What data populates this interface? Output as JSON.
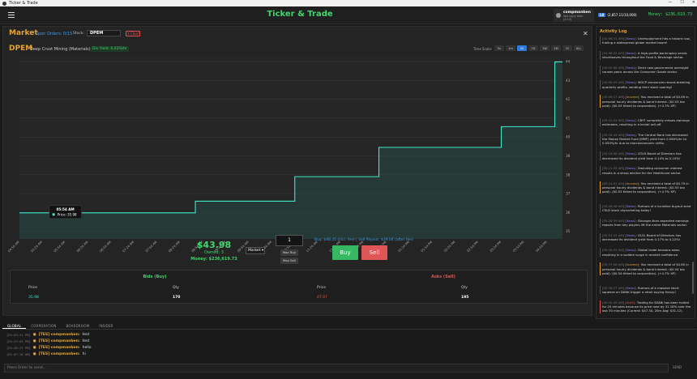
{
  "window": {
    "title": "Ticker & Trade",
    "controls": [
      "—",
      "☐",
      "✕"
    ]
  },
  "header": {
    "title": "Ticker & Trade",
    "user": {
      "name": "compmanben",
      "subtitle": "lost copy bots (2:13)"
    },
    "level": "L8",
    "xp": "(2,857.11/10,000)",
    "money": "Money: $236,619.73"
  },
  "market": {
    "title": "Market",
    "open_orders": "Open Orders: 0/15",
    "stock_label": "Stock:",
    "stock_value": "DPEM",
    "clear_label": "X Clear",
    "close": "✕",
    "ticker": "DPEM",
    "company": "Deep Crust Mining (Materials)",
    "div_yield": "Div Yield: 0.03%/hr",
    "timescale_label": "Time Scale:",
    "timescales": [
      "5s",
      "1m",
      "1h",
      "1D",
      "1W",
      "1M",
      "1Y",
      "ALL"
    ],
    "active_timescale": "1h",
    "tooltip_time": "05:54 AM",
    "tooltip_price": "Price: 35.98",
    "price_big": "$43.98",
    "owned": "Owned: 3",
    "money": "Money: $236,619.73",
    "order_type": "Market",
    "quantity": "1",
    "max_buy": "Max Buy",
    "max_sell": "Max Sell",
    "payout": "Buy: $48.35 (incl. fee) | Sell Payout: $39.04 (after fee)",
    "buy_label": "Buy",
    "sell_label": "Sell",
    "bids_title": "Bids (Buy)",
    "asks_title": "Asks (Sell)",
    "price_col": "Price",
    "qty_col": "Qty",
    "bid_price": "35.98",
    "bid_qty": "170",
    "ask_price": "47.97",
    "ask_qty": "195"
  },
  "chart_data": {
    "type": "line",
    "x": [
      "04:54 AM",
      "05:04 AM",
      "05:14 AM",
      "05:24 AM",
      "05:34 AM",
      "05:44 AM",
      "05:54 AM",
      "06:04 AM",
      "06:14 AM",
      "06:24 AM",
      "06:34 AM",
      "06:44 AM",
      "06:54 AM",
      "07:04 AM",
      "07:14 AM",
      "07:24 AM",
      "07:34 AM",
      "07:44 AM",
      "07:54 AM",
      "08:04 AM",
      "08:14 AM",
      "08:24 AM",
      "08:34 AM",
      "08:44 AM",
      "08:54 AM",
      "09:04 AM",
      "09:14 AM",
      "09:24 AM",
      "09:34 AM",
      "09:44 AM",
      "09:54 AM",
      "10:04 AM",
      "10:14 AM",
      "10:24 AM",
      "10:34 AM",
      "10:44 AM",
      "10:54 AM",
      "11:04 AM",
      "11:14 AM",
      "11:24 AM",
      "11:34 AM",
      "11:44 AM",
      "11:54 AM",
      "12:04 PM",
      "12:14 PM",
      "12:24 PM",
      "12:34 PM",
      "12:44 PM",
      "12:54 PM",
      "01:04 PM",
      "01:14 PM",
      "01:24 PM",
      "01:34 PM",
      "01:44 PM",
      "01:54 PM",
      "02:04 PM",
      "02:14 PM",
      "02:24 PM",
      "02:34 PM",
      "02:44 PM",
      "02:54 PM",
      "03:04 PM",
      "03:14 PM",
      "03:24 PM",
      "03:34 PM",
      "03:44 PM",
      "03:54 PM",
      "04:04 PM",
      "04:14 PM",
      "04:24 PM",
      "04:34 PM",
      "04:44 PM"
    ],
    "series": [
      {
        "values": [
          35.98,
          35.98,
          35.98,
          35.98,
          35.98,
          35.98,
          35.98,
          35.98,
          35.98,
          35.98,
          35.98,
          35.98,
          35.98,
          35.98,
          35.98,
          35.98,
          35.98,
          35.98,
          35.98,
          35.98,
          35.98,
          35.98,
          35.98,
          36.6,
          36.6,
          36.6,
          36.6,
          36.6,
          36.6,
          36.6,
          36.6,
          36.6,
          36.6,
          36.6,
          36.6,
          36.6,
          37.9,
          37.9,
          37.9,
          37.9,
          37.9,
          37.9,
          37.9,
          37.9,
          37.9,
          37.9,
          37.9,
          39.45,
          39.45,
          39.45,
          39.45,
          39.45,
          39.45,
          39.45,
          39.45,
          39.45,
          39.45,
          39.45,
          39.45,
          39.45,
          39.45,
          39.45,
          39.45,
          40.55,
          40.55,
          40.55,
          40.55,
          40.55,
          40.55,
          40.55,
          43.98,
          43.98
        ]
      }
    ],
    "x_ticks": [
      "04:54 AM",
      "05:24 AM",
      "05:54 AM",
      "06:24 AM",
      "06:54 AM",
      "07:24 AM",
      "07:54 AM",
      "08:24 AM",
      "08:54 AM",
      "09:24 AM",
      "09:54 AM",
      "10:24 AM",
      "10:54 AM",
      "11:24 AM",
      "11:54 AM",
      "12:24 PM",
      "12:54 PM",
      "01:24 PM",
      "01:54 PM",
      "02:24 PM",
      "02:54 PM",
      "03:24 PM",
      "03:54 PM",
      "04:24 PM"
    ],
    "y_ticks": [
      35,
      36,
      37,
      38,
      39,
      40,
      41,
      42,
      43,
      44
    ],
    "ylim": [
      34.6,
      44.3
    ],
    "grid": true,
    "colors": {
      "line": "#3ee8c8",
      "fill": "#244a46",
      "grid": "#3a3a3a"
    }
  },
  "tabs": [
    "GLOBAL",
    "CORPORATION",
    "BOARDROOM",
    "INSIDER"
  ],
  "active_tab": "GLOBAL",
  "chat": [
    {
      "ts": "[04:03:31 PM]",
      "who": "[TES] compmanben:",
      "msg": "test"
    },
    {
      "ts": "[04:23:03 PM]",
      "who": "[TES] compmanben:",
      "msg": "test"
    },
    {
      "ts": "[04:30:17 PM]",
      "who": "[TES] compmanben:",
      "msg": "hello"
    },
    {
      "ts": "[01:07:18 AM]",
      "who": "[TES] compmanben:",
      "msg": "hi"
    }
  ],
  "chat_placeholder": "Press Enter to send...",
  "send_label": "SEND",
  "activity": {
    "title": "Activity Log",
    "entries": [
      {
        "kind": "news",
        "ts": "[04:56:31 AM]",
        "tag": "[News]:",
        "text": "Unemployment hits a historic low, fueling a widespread global market boom!"
      },
      {
        "kind": "news",
        "ts": "[04:58:02 AM]",
        "tag": "[News]:",
        "text": "A high-profile bankruptcy sends shockwaves throughout the Food & Beverage sector."
      },
      {
        "kind": "news",
        "ts": "[05:02:08 AM]",
        "tag": "[News]:",
        "text": "Strict new government oversight causes panic across the Consumer Goods sector."
      },
      {
        "kind": "news",
        "ts": "[05:06:09 AM]",
        "tag": "[News]:",
        "text": "MGCP announces record-breaking quarterly profits, sending their stock soaring!"
      },
      {
        "kind": "income",
        "ts": "[05:09:17 AM]",
        "tag": "[Income]:",
        "text": "You received a total of $5.69 in personal hourly dividends & bond interest. ($0.53 tax paid). ($0.53 tithed to corporation). (+4.7% XP)"
      },
      {
        "kind": "news",
        "ts": "[05:12:34 AM]",
        "tag": "[News]:",
        "text": "CBYT completely misses earnings estimates, resulting in a brutal sell-off."
      },
      {
        "kind": "news",
        "ts": "[05:16:44 AM]",
        "tag": "[News]:",
        "text": "The Central Bank has decreased the Money Market Fund (MMF) yield from 0.060%/hr to 0.050%/hr due to macroeconomic shifts."
      },
      {
        "kind": "news",
        "ts": "[05:19:08 AM]",
        "tag": "[News]:",
        "text": "GTLN Board of Directors has decreased its dividend yield from 0.14% to 0.10%!"
      },
      {
        "kind": "news",
        "ts": "[05:21:55 AM]",
        "tag": "[News]:",
        "text": "Dwindling consumer interest results in a sharp decline for the Healthcare sector."
      },
      {
        "kind": "income",
        "ts": "[05:24:02 AM]",
        "tag": "[Income]:",
        "text": "You received a total of $5.79 in personal hourly dividends & bond interest. ($0.53 tax paid). ($0.53 tithed to corporation). (+4.7% XP)"
      },
      {
        "kind": "news",
        "ts": "[05:26:46 AM]",
        "tag": "[News]:",
        "text": "Rumors of a lucrative buyout send CSLD stock skyrocketing today!"
      },
      {
        "kind": "news",
        "ts": "[05:28:39 AM]",
        "tag": "[News]:",
        "text": "Stronger-than-expected earnings reports from key players lift the entire Materials sector."
      },
      {
        "kind": "news",
        "ts": "[05:31:15 AM]",
        "tag": "[News]:",
        "text": "GLSL Board of Directors has decreased its dividend yield from 0.17% to 0.22%!"
      },
      {
        "kind": "news",
        "ts": "[05:34:02 AM]",
        "tag": "[News]:",
        "text": "Global trade tensions ease, resulting in a sudden surge in market confidence."
      },
      {
        "kind": "income",
        "ts": "[05:37:06 AM]",
        "tag": "[Income]:",
        "text": "You received a total of $5.60 in personal hourly dividends & bond interest. ($0.54 tax paid). ($0.54 tithed to corporation). (+4.7% XP)"
      },
      {
        "kind": "news",
        "ts": "[05:39:27 AM]",
        "tag": "[News]:",
        "text": "Rumors of a massive short squeeze on DANK trigger a retail buying frenzy!"
      },
      {
        "kind": "alert",
        "ts": "[05:42:49 AM]",
        "tag": "[Alert]:",
        "text": "Trading for DANK has been halted for 20 minutes because its price rose by 31.18% over the last 30 minutes (Current: $47.34, 20m Avg: $31.12)."
      },
      {
        "kind": "news",
        "ts": "[05:45:10 AM]",
        "tag": "[News]:",
        "text": "GLSL Board of Directors has decreased its dividend yield from 0.22% to 0.17%!"
      },
      {
        "kind": "news",
        "ts": "[05:48:38 AM]",
        "tag": "[News]:",
        "text": "A sudden trend shift brings immense capital into the Materials sector today."
      }
    ]
  }
}
